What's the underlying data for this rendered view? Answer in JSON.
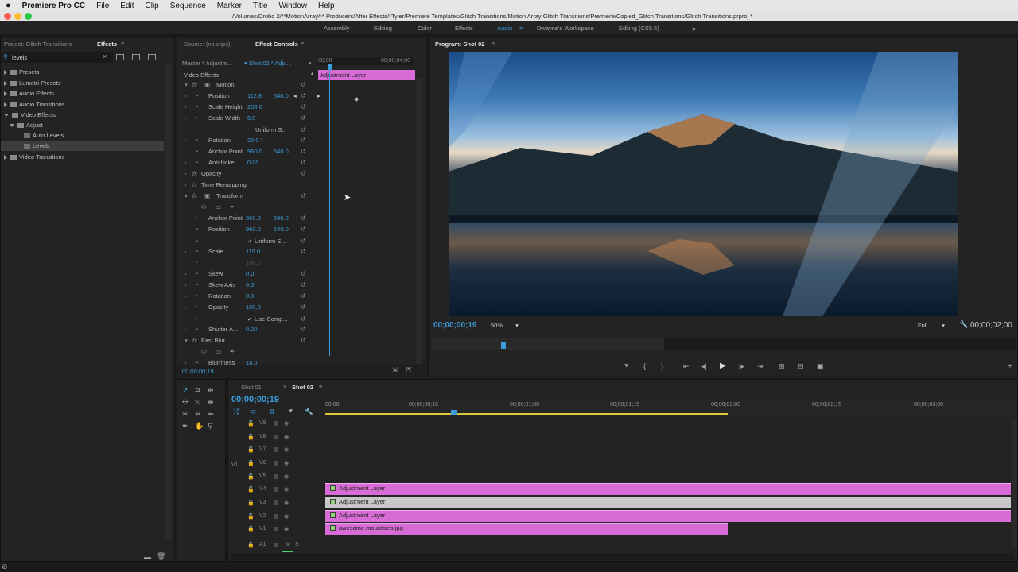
{
  "menubar": {
    "app": "Premiere Pro CC",
    "items": [
      "File",
      "Edit",
      "Clip",
      "Sequence",
      "Marker",
      "Title",
      "Window",
      "Help"
    ]
  },
  "window": {
    "title": "/Volumes/Drobo 2/**MotionArray/** Producers/After Effects/*Tyler/Premiere Templates/Glitch Transitions/Motion Array Glitch Transitions/Premiere/Copied_Glitch Transitions/Glitch Transitions.prproj *"
  },
  "workspaces": [
    "Assembly",
    "Editing",
    "Color",
    "Effects",
    "Audio",
    "Dwayne's Workspace",
    "Editing (CS5.5)"
  ],
  "effects_panel": {
    "tab_project": "Project: Glitch Transitions",
    "tab_effects": "Effects",
    "search_value": "levels",
    "tree": [
      {
        "label": "Presets"
      },
      {
        "label": "Lumetri Presets"
      },
      {
        "label": "Audio Effects"
      },
      {
        "label": "Audio Transitions"
      },
      {
        "label": "Video Effects"
      },
      {
        "label": "Adjust"
      },
      {
        "label": "Auto Levels"
      },
      {
        "label": "Levels"
      },
      {
        "label": "Video Transitions"
      }
    ]
  },
  "effect_controls": {
    "tab_source": "Source: (no clips)",
    "tab_ec": "Effect Controls",
    "master": "Master * Adjustm...",
    "sequence": "Shot 02 * Adju...",
    "section": "Video Effects",
    "time_start": "00;00",
    "time_end": "00;00;04;00",
    "clip_label": "Adjustment Layer",
    "timecode": "00;00;00;19",
    "rows": [
      {
        "label": "Motion",
        "v1": "",
        "v2": ""
      },
      {
        "label": "Position",
        "v1": "112.8",
        "v2": "540.0"
      },
      {
        "label": "Scale Height",
        "v1": "208.0",
        "v2": ""
      },
      {
        "label": "Scale Width",
        "v1": "5.0",
        "v2": ""
      },
      {
        "label": "Uniform S...",
        "v1": "",
        "v2": ""
      },
      {
        "label": "Rotation",
        "v1": "20.0 °",
        "v2": ""
      },
      {
        "label": "Anchor Point",
        "v1": "960.0",
        "v2": "540.0"
      },
      {
        "label": "Anti-flicke...",
        "v1": "0.00",
        "v2": ""
      },
      {
        "label": "Opacity",
        "v1": "",
        "v2": ""
      },
      {
        "label": "Time Remapping",
        "v1": "",
        "v2": ""
      },
      {
        "label": "Transform",
        "v1": "",
        "v2": ""
      },
      {
        "label": "",
        "v1": "",
        "v2": ""
      },
      {
        "label": "Anchor Point",
        "v1": "960.0",
        "v2": "540.0"
      },
      {
        "label": "Position",
        "v1": "960.0",
        "v2": "540.0"
      },
      {
        "label": "Uniform S...",
        "v1": "",
        "v2": ""
      },
      {
        "label": "Scale",
        "v1": "119.0",
        "v2": ""
      },
      {
        "label": "",
        "v1": "100.0",
        "v2": ""
      },
      {
        "label": "Skew",
        "v1": "0.0",
        "v2": ""
      },
      {
        "label": "Skew Axis",
        "v1": "0.0",
        "v2": ""
      },
      {
        "label": "Rotation",
        "v1": "0.0",
        "v2": ""
      },
      {
        "label": "Opacity",
        "v1": "100.0",
        "v2": ""
      },
      {
        "label": "Use Comp...",
        "v1": "",
        "v2": ""
      },
      {
        "label": "Shutter A...",
        "v1": "0.00",
        "v2": ""
      },
      {
        "label": "Fast Blur",
        "v1": "",
        "v2": ""
      },
      {
        "label": "",
        "v1": "",
        "v2": ""
      },
      {
        "label": "Blurriness",
        "v1": "18.0",
        "v2": ""
      }
    ]
  },
  "program": {
    "tab": "Program: Shot 02",
    "timecode": "00;00;00;19",
    "zoom": "50%",
    "quality": "Full",
    "duration": "00;00;02;00"
  },
  "timeline": {
    "tab1": "Shot 01",
    "tab2": "Shot 02",
    "timecode": "00;00;00;19",
    "ruler": [
      "00;00",
      "00;00;00;15",
      "00;00;01;00",
      "00;00;01;15",
      "00;00;02;00",
      "00;00;02;15",
      "00;00;03;00"
    ],
    "tracks": [
      "V9",
      "V8",
      "V7",
      "V6",
      "V5",
      "V4",
      "V3",
      "V2",
      "V1",
      "A1"
    ],
    "source_patch": "V1",
    "clips": [
      {
        "label": "Adjustment Layer"
      },
      {
        "label": "Adjustment Layer"
      },
      {
        "label": "Adjustment Layer"
      },
      {
        "label": "awesome mountains.jpg"
      }
    ]
  },
  "colors": {
    "accent": "#3b9ddb",
    "clip": "#d86cd6",
    "clip_selected": "#c8c8c8",
    "playhead": "#5aa8d6"
  }
}
